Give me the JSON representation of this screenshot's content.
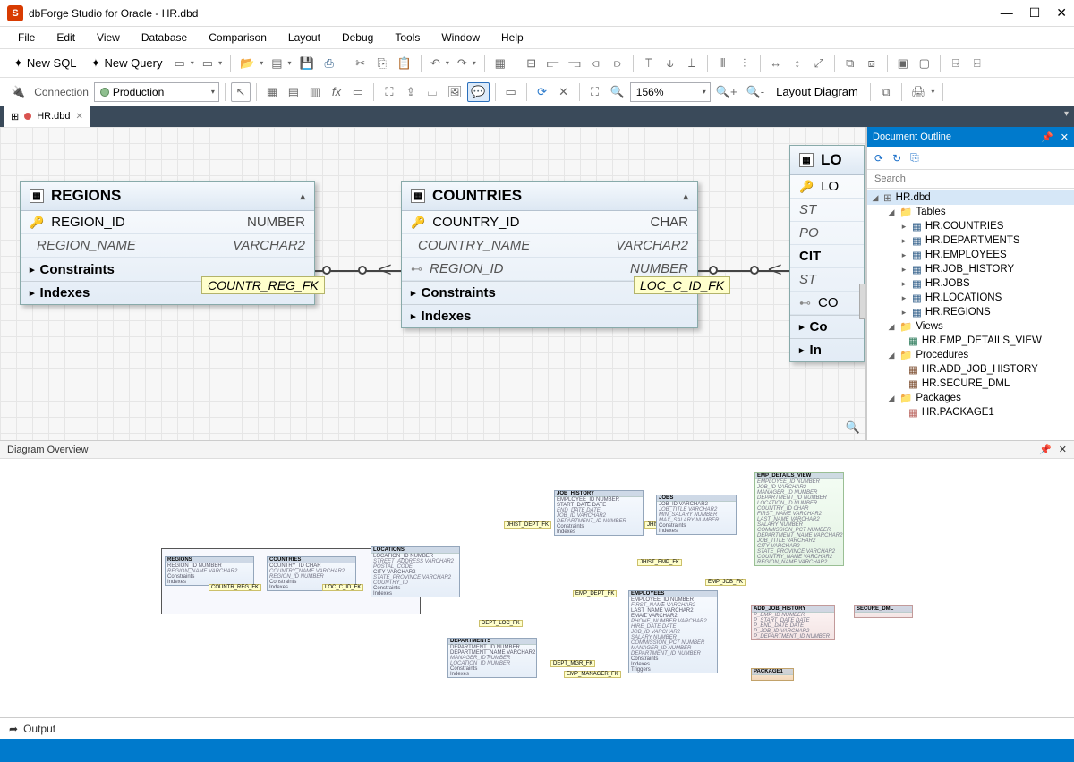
{
  "title": "dbForge Studio for Oracle - HR.dbd",
  "app_icon_letter": "S",
  "menus": [
    "File",
    "Edit",
    "View",
    "Database",
    "Comparison",
    "Layout",
    "Debug",
    "Tools",
    "Window",
    "Help"
  ],
  "toolbar1": {
    "new_sql": "New SQL",
    "new_query": "New Query"
  },
  "toolbar2": {
    "connection_label": "Connection",
    "connection_value": "Production",
    "zoom_value": "156%",
    "layout_btn": "Layout Diagram"
  },
  "tab": {
    "label": "HR.dbd"
  },
  "er": {
    "regions": {
      "title": "REGIONS",
      "cols": [
        {
          "key": "pk",
          "name": "REGION_ID",
          "type": "NUMBER"
        },
        {
          "key": "",
          "name": "REGION_NAME",
          "type": "VARCHAR2"
        }
      ],
      "sections": [
        "Constraints",
        "Indexes"
      ]
    },
    "countries": {
      "title": "COUNTRIES",
      "cols": [
        {
          "key": "pk",
          "name": "COUNTRY_ID",
          "type": "CHAR"
        },
        {
          "key": "",
          "name": "COUNTRY_NAME",
          "type": "VARCHAR2"
        },
        {
          "key": "fk",
          "name": "REGION_ID",
          "type": "NUMBER"
        }
      ],
      "sections": [
        "Constraints",
        "Indexes"
      ]
    },
    "locations_partial": {
      "title": "LO",
      "rows": [
        "LO",
        "ST",
        "PO",
        "CIT",
        "ST",
        "CO"
      ],
      "sections": [
        "Co",
        "In"
      ]
    },
    "fk1": "COUNTR_REG_FK",
    "fk2": "LOC_C_ID_FK"
  },
  "outline": {
    "title": "Document Outline",
    "search_placeholder": "Search",
    "root": "HR.dbd",
    "folders": {
      "tables": {
        "label": "Tables",
        "items": [
          "HR.COUNTRIES",
          "HR.DEPARTMENTS",
          "HR.EMPLOYEES",
          "HR.JOB_HISTORY",
          "HR.JOBS",
          "HR.LOCATIONS",
          "HR.REGIONS"
        ]
      },
      "views": {
        "label": "Views",
        "items": [
          "HR.EMP_DETAILS_VIEW"
        ]
      },
      "procedures": {
        "label": "Procedures",
        "items": [
          "HR.ADD_JOB_HISTORY",
          "HR.SECURE_DML"
        ]
      },
      "packages": {
        "label": "Packages",
        "items": [
          "HR.PACKAGE1"
        ]
      }
    }
  },
  "overview": {
    "title": "Diagram Overview",
    "boxes": {
      "regions": {
        "t": "REGIONS",
        "rows": [
          "REGION_ID   NUMBER",
          "REGION_NAME VARCHAR2",
          "Constraints",
          "Indexes"
        ]
      },
      "countries": {
        "t": "COUNTRIES",
        "rows": [
          "COUNTRY_ID   CHAR",
          "COUNTRY_NAME VARCHAR2",
          "REGION_ID   NUMBER",
          "Constraints",
          "Indexes"
        ]
      },
      "locations": {
        "t": "LOCATIONS",
        "rows": [
          "LOCATION_ID   NUMBER",
          "STREET_ADDRESS VARCHAR2",
          "POSTAL_CODE",
          "CITY   VARCHAR2",
          "STATE_PROVINCE VARCHAR2",
          "COUNTRY_ID",
          "Constraints",
          "Indexes"
        ]
      },
      "departments": {
        "t": "DEPARTMENTS",
        "rows": [
          "DEPARTMENT_ID  NUMBER",
          "DEPARTMENT_NAME VARCHAR2",
          "MANAGER_ID  NUMBER",
          "LOCATION_ID  NUMBER",
          "Constraints",
          "Indexes"
        ]
      },
      "job_history": {
        "t": "JOB_HISTORY",
        "rows": [
          "EMPLOYEE_ID  NUMBER",
          "START_DATE  DATE",
          "END_DATE  DATE",
          "JOB_ID  VARCHAR2",
          "DEPARTMENT_ID NUMBER",
          "Constraints",
          "Indexes"
        ]
      },
      "jobs": {
        "t": "JOBS",
        "rows": [
          "JOB_ID  VARCHAR2",
          "JOB_TITLE  VARCHAR2",
          "MIN_SALARY NUMBER",
          "MAX_SALARY NUMBER",
          "Constraints",
          "Indexes"
        ]
      },
      "employees": {
        "t": "EMPLOYEES",
        "rows": [
          "EMPLOYEE_ID  NUMBER",
          "FIRST_NAME  VARCHAR2",
          "LAST_NAME  VARCHAR2",
          "EMAIL  VARCHAR2",
          "PHONE_NUMBER VARCHAR2",
          "HIRE_DATE  DATE",
          "JOB_ID  VARCHAR2",
          "SALARY  NUMBER",
          "COMMISSION_PCT NUMBER",
          "MANAGER_ID  NUMBER",
          "DEPARTMENT_ID NUMBER",
          "Constraints",
          "Indexes",
          "Triggers"
        ]
      },
      "emp_details": {
        "t": "EMP_DETAILS_VIEW",
        "rows": [
          "EMPLOYEE_ID  NUMBER",
          "JOB_ID  VARCHAR2",
          "MANAGER_ID  NUMBER",
          "DEPARTMENT_ID NUMBER",
          "LOCATION_ID  NUMBER",
          "COUNTRY_ID  CHAR",
          "FIRST_NAME  VARCHAR2",
          "LAST_NAME  VARCHAR2",
          "SALARY  NUMBER",
          "COMMISSION_PCT NUMBER",
          "DEPARTMENT_NAME VARCHAR2",
          "JOB_TITLE  VARCHAR2",
          "CITY  VARCHAR2",
          "STATE_PROVINCE VARCHAR2",
          "COUNTRY_NAME VARCHAR2",
          "REGION_NAME VARCHAR2"
        ]
      },
      "add_job_history": {
        "t": "ADD_JOB_HISTORY",
        "rows": [
          "P_EMP_ID  NUMBER",
          "P_START_DATE DATE",
          "P_END_DATE  DATE",
          "P_JOB_ID  VARCHAR2",
          "P_DEPARTMENT_ID NUMBER"
        ]
      },
      "secure_dml": {
        "t": "SECURE_DML"
      },
      "package1": {
        "t": "PACKAGE1"
      }
    },
    "ov_fks": [
      "COUNTR_REG_FK",
      "LOC_C_ID_FK",
      "DEPT_LOC_FK",
      "DEPT_MGR_FK",
      "JHIST_DEPT_FK",
      "JHIST_JOB_FK",
      "JHIST_EMP_FK",
      "EMP_DEPT_FK",
      "EMP_JOB_FK",
      "EMP_MANAGER_FK"
    ]
  },
  "output_label": "Output"
}
